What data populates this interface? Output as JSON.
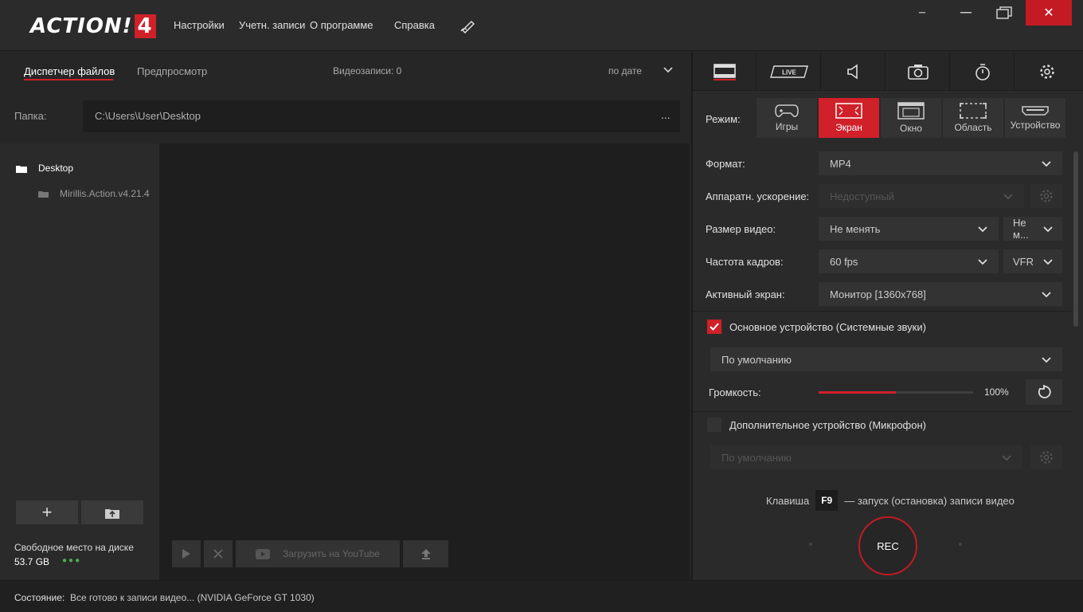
{
  "app": {
    "logo_text": "ACTION!",
    "logo_version": "4"
  },
  "menu": {
    "settings": "Настройки",
    "accounts": "Учетн. записи",
    "about": "О программе",
    "help": "Справка"
  },
  "left": {
    "tab_files": "Диспетчер файлов",
    "tab_preview": "Предпросмотр",
    "video_count": "Видеозаписи: 0",
    "sort": "по дате",
    "folder_label": "Папка:",
    "folder_path": "C:\\Users\\User\\Desktop",
    "folder_more": "...",
    "tree": [
      "Desktop",
      "Mirillis.Action.v4.21.4"
    ],
    "free_label": "Свободное место на диске",
    "free_value": "53.7 GB",
    "youtube_btn": "Загрузить на YouTube"
  },
  "right": {
    "mode_label": "Режим:",
    "modes": [
      "Игры",
      "Экран",
      "Окно",
      "Область",
      "Устройство"
    ],
    "active_mode": "Экран",
    "format_label": "Формат:",
    "format_value": "MP4",
    "hw_label": "Аппаратн. ускорение:",
    "hw_value": "Недоступный",
    "size_label": "Размер видео:",
    "size_value": "Не менять",
    "size_value2": "Не м...",
    "fps_label": "Частота кадров:",
    "fps_value": "60 fps",
    "fps_mode": "VFR",
    "screen_label": "Активный экран:",
    "screen_value": "Монитор [1360x768]",
    "main_device_label": "Основное устройство (Системные звуки)",
    "main_device_value": "По умолчанию",
    "main_device_checked": true,
    "volume_label": "Громкость:",
    "volume_value": "100%",
    "volume_level": 0.5,
    "mic_label": "Дополнительное устройство (Микрофон)",
    "mic_value": "По умолчанию",
    "mic_checked": false,
    "hotkey_prefix": "Клавиша",
    "hotkey_key": "F9",
    "hotkey_suffix": "— запуск (остановка) записи видео",
    "rec_label": "REC",
    "live_label": "LIVE"
  },
  "status": {
    "label": "Состояние:",
    "text": "Все готово к записи видео... (NVIDIA GeForce GT 1030)"
  },
  "colors": {
    "accent": "#d0202a",
    "bg": "#262626",
    "success": "#4caf50"
  }
}
